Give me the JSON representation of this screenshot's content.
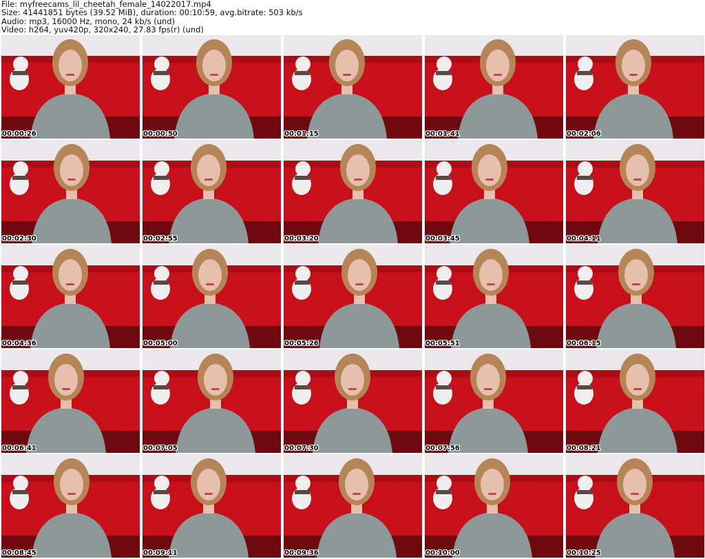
{
  "info": {
    "file": "File: myfreecams_lil_cheetah_female_14022017.mp4",
    "size": "Size: 41441851 bytes (39.52 MiB), duration: 00:10:59, avg.bitrate: 503 kb/s",
    "audio": "Audio: mp3, 16000 Hz, mono, 24 kb/s (und)",
    "video": "Video: h264, yuv420p, 320x240, 27.83 fps(r) (und)"
  },
  "thumbnails": [
    {
      "time": "00:00:26"
    },
    {
      "time": "00:00:50"
    },
    {
      "time": "00:01:15"
    },
    {
      "time": "00:01:41"
    },
    {
      "time": "00:02:06"
    },
    {
      "time": "00:02:30"
    },
    {
      "time": "00:02:55"
    },
    {
      "time": "00:03:20"
    },
    {
      "time": "00:03:45"
    },
    {
      "time": "00:04:11"
    },
    {
      "time": "00:04:36"
    },
    {
      "time": "00:05:00"
    },
    {
      "time": "00:05:26"
    },
    {
      "time": "00:05:51"
    },
    {
      "time": "00:06:15"
    },
    {
      "time": "00:06:41"
    },
    {
      "time": "00:07:05"
    },
    {
      "time": "00:07:30"
    },
    {
      "time": "00:07:56"
    },
    {
      "time": "00:08:21"
    },
    {
      "time": "00:08:45"
    },
    {
      "time": "00:09:11"
    },
    {
      "time": "00:09:36"
    },
    {
      "time": "00:10:00"
    },
    {
      "time": "00:10:25"
    }
  ],
  "colors": {
    "wall": "#ebe8eb",
    "sofa": "#c8101a",
    "sofa_dark": "#8e0a10",
    "sweater": "#8d9899",
    "skin": "#e7bfae",
    "hair": "#b68556",
    "plush": "#eeeeee"
  }
}
